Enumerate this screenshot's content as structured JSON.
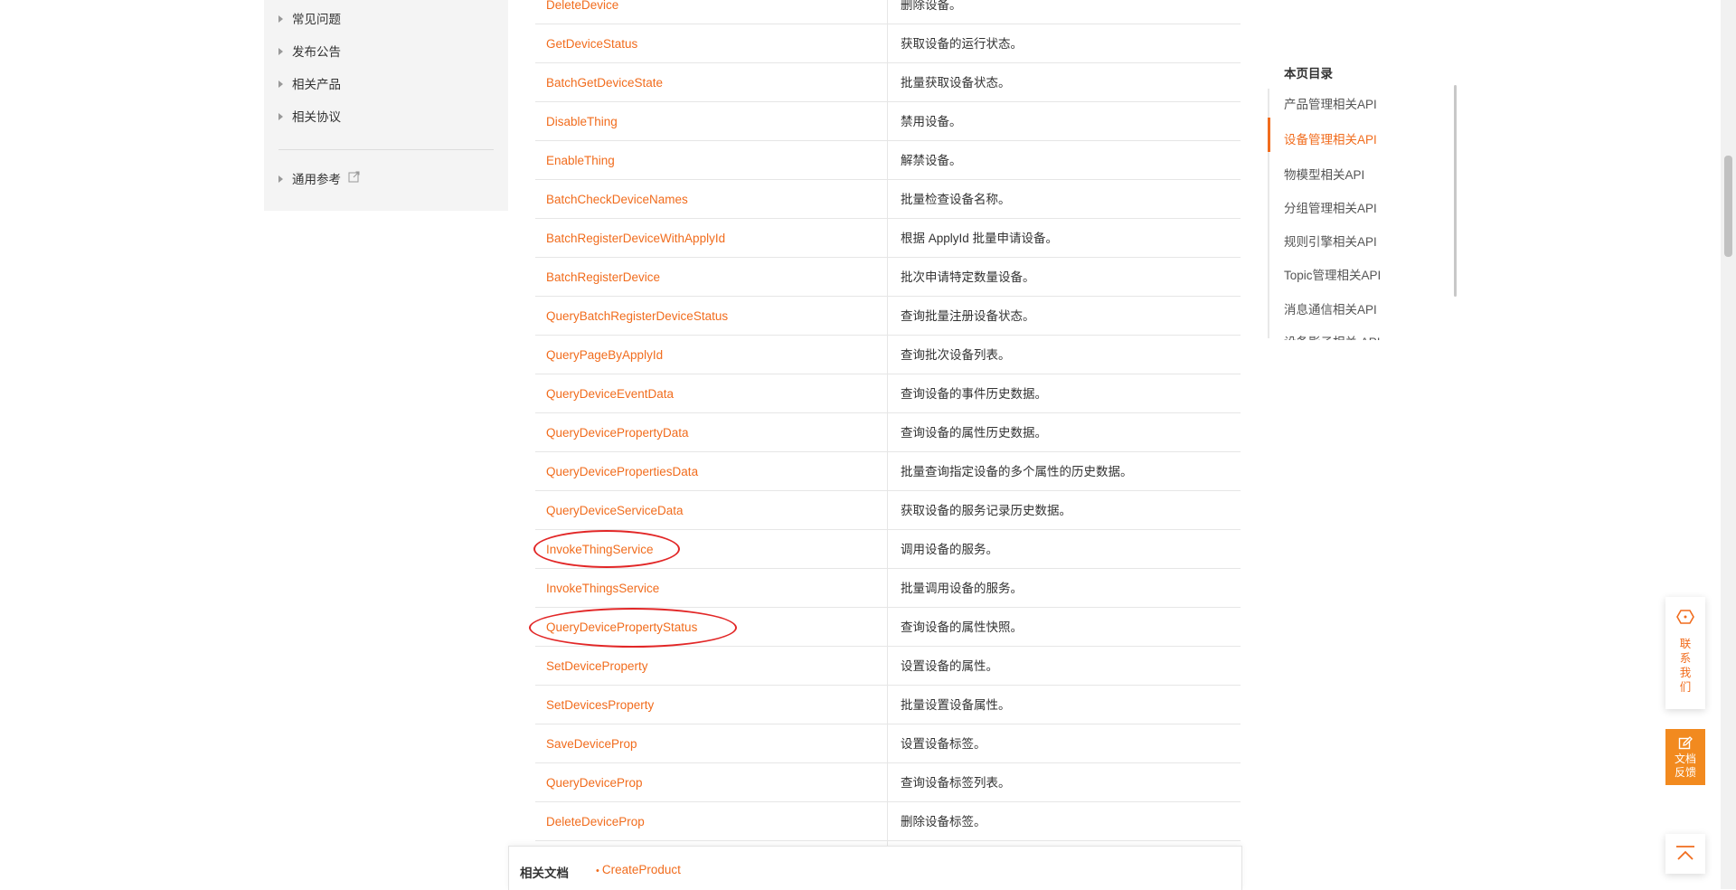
{
  "left_nav": {
    "items": [
      {
        "label": "常见问题"
      },
      {
        "label": "发布公告"
      },
      {
        "label": "相关产品"
      },
      {
        "label": "相关协议"
      }
    ],
    "general_ref": {
      "label": "通用参考",
      "icon": "external-link-icon"
    }
  },
  "api_table": {
    "rows": [
      {
        "api": "DeleteDevice",
        "desc": "删除设备。"
      },
      {
        "api": "GetDeviceStatus",
        "desc": "获取设备的运行状态。"
      },
      {
        "api": "BatchGetDeviceState",
        "desc": "批量获取设备状态。"
      },
      {
        "api": "DisableThing",
        "desc": "禁用设备。"
      },
      {
        "api": "EnableThing",
        "desc": "解禁设备。"
      },
      {
        "api": "BatchCheckDeviceNames",
        "desc": "批量检查设备名称。"
      },
      {
        "api": "BatchRegisterDeviceWithApplyId",
        "desc": "根据 ApplyId 批量申请设备。"
      },
      {
        "api": "BatchRegisterDevice",
        "desc": "批次申请特定数量设备。"
      },
      {
        "api": "QueryBatchRegisterDeviceStatus",
        "desc": "查询批量注册设备状态。"
      },
      {
        "api": "QueryPageByApplyId",
        "desc": "查询批次设备列表。"
      },
      {
        "api": "QueryDeviceEventData",
        "desc": "查询设备的事件历史数据。"
      },
      {
        "api": "QueryDevicePropertyData",
        "desc": "查询设备的属性历史数据。"
      },
      {
        "api": "QueryDevicePropertiesData",
        "desc": "批量查询指定设备的多个属性的历史数据。"
      },
      {
        "api": "QueryDeviceServiceData",
        "desc": "获取设备的服务记录历史数据。"
      },
      {
        "api": "InvokeThingService",
        "desc": "调用设备的服务。"
      },
      {
        "api": "InvokeThingsService",
        "desc": "批量调用设备的服务。"
      },
      {
        "api": "QueryDevicePropertyStatus",
        "desc": "查询设备的属性快照。"
      },
      {
        "api": "SetDeviceProperty",
        "desc": "设置设备的属性。"
      },
      {
        "api": "SetDevicesProperty",
        "desc": "批量设置设备属性。"
      },
      {
        "api": "SaveDeviceProp",
        "desc": "设置设备标签。"
      },
      {
        "api": "QueryDeviceProp",
        "desc": "查询设备标签列表。"
      },
      {
        "api": "DeleteDeviceProp",
        "desc": "删除设备标签。"
      }
    ]
  },
  "related_docs": {
    "title": "相关文档",
    "link": "CreateProduct"
  },
  "toc": {
    "title": "本页目录",
    "items": [
      {
        "label": "产品管理相关API"
      },
      {
        "label": "设备管理相关API",
        "active": true
      },
      {
        "label": "物模型相关API"
      },
      {
        "label": "分组管理相关API"
      },
      {
        "label": "规则引擎相关API"
      },
      {
        "label": "Topic管理相关API"
      },
      {
        "label": "消息通信相关API"
      },
      {
        "label": "设备影子相关 API"
      }
    ]
  },
  "floating": {
    "contact": {
      "label": "联系我们",
      "icon": "contact-icon"
    },
    "feedback": {
      "label": "文档反馈",
      "icon": "edit-icon"
    },
    "top": {
      "icon": "back-to-top-icon"
    }
  },
  "colors": {
    "accent": "#f16c1d",
    "annotation": "#e22727",
    "feedback_bg": "#f28a1f"
  }
}
